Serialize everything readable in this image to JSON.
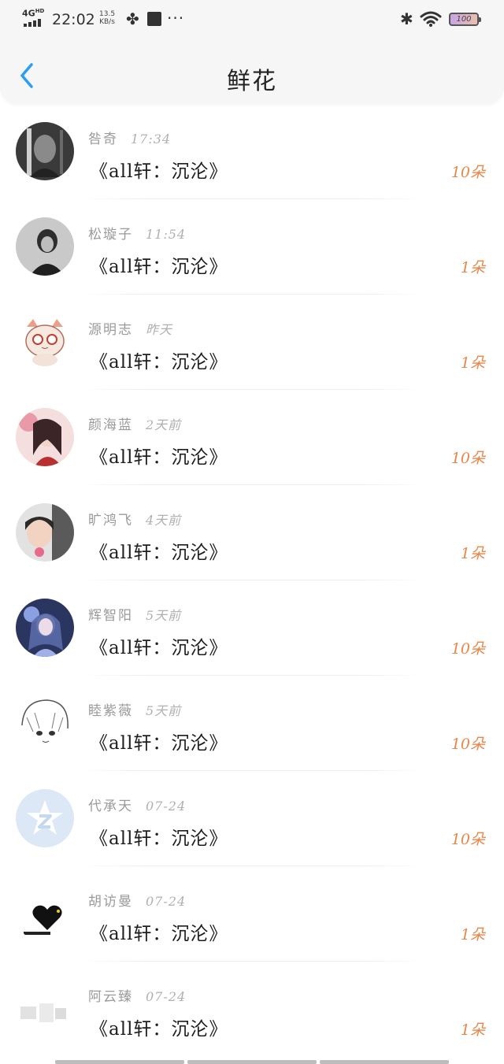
{
  "status_bar": {
    "network": "4G",
    "network_sup": "HD",
    "time": "22:02",
    "speed_value": "13.5",
    "speed_unit": "KB/s",
    "more": "···",
    "battery": "100"
  },
  "header": {
    "title": "鲜花",
    "back_icon": "chevron-left-icon"
  },
  "colors": {
    "count": "#e8874a",
    "back": "#2a9df4",
    "name": "#9a9a9a"
  },
  "items": [
    {
      "name": "咎奇",
      "time": "17:34",
      "work": "《all轩：沉沦》",
      "count": "10朵"
    },
    {
      "name": "松璇子",
      "time": "11:54",
      "work": "《all轩：沉沦》",
      "count": "1朵"
    },
    {
      "name": "源明志",
      "time": "昨天",
      "work": "《all轩：沉沦》",
      "count": "1朵"
    },
    {
      "name": "颜海蓝",
      "time": "2天前",
      "work": "《all轩：沉沦》",
      "count": "10朵"
    },
    {
      "name": "旷鸿飞",
      "time": "4天前",
      "work": "《all轩：沉沦》",
      "count": "1朵"
    },
    {
      "name": "辉智阳",
      "time": "5天前",
      "work": "《all轩：沉沦》",
      "count": "10朵"
    },
    {
      "name": "睦紫薇",
      "time": "5天前",
      "work": "《all轩：沉沦》",
      "count": "10朵"
    },
    {
      "name": "代承天",
      "time": "07-24",
      "work": "《all轩：沉沦》",
      "count": "10朵"
    },
    {
      "name": "胡访曼",
      "time": "07-24",
      "work": "《all轩：沉沦》",
      "count": "1朵"
    },
    {
      "name": "阿云臻",
      "time": "07-24",
      "work": "《all轩：沉沦》",
      "count": "1朵"
    }
  ]
}
